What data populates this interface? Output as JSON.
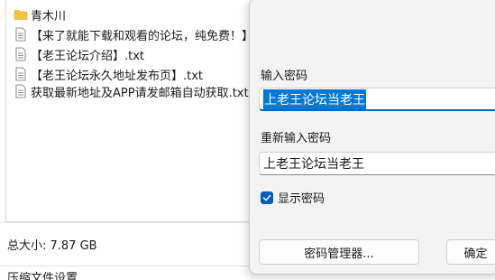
{
  "files": [
    {
      "name": "青木川",
      "type": "folder",
      "icon": "folder-icon"
    },
    {
      "name": "【来了就能下载和观看的论坛，纯免费！】.txt",
      "type": "text",
      "icon": "text-file-icon"
    },
    {
      "name": "【老王论坛介绍】.txt",
      "type": "text",
      "icon": "text-file-icon"
    },
    {
      "name": "【老王论坛永久地址发布页】.txt",
      "type": "text",
      "icon": "text-file-icon"
    },
    {
      "name": "获取最新地址及APP请发邮箱自动获取.txt",
      "type": "text",
      "icon": "text-file-icon"
    }
  ],
  "status": {
    "total_size": "总大小: 7.87 GB",
    "bottom_text": "压缩文件设置"
  },
  "dialog": {
    "password_label": "输入密码",
    "password_value": "上老王论坛当老王",
    "reenter_label": "重新输入密码",
    "reenter_value": "上老王论坛当老王",
    "show_password_label": "显示密码",
    "show_password_checked": true,
    "manager_button": "密码管理器...",
    "ok_button": "确定"
  },
  "colors": {
    "accent": "#0078d4",
    "checkbox": "#005fb8",
    "folder": "#f4c542"
  }
}
